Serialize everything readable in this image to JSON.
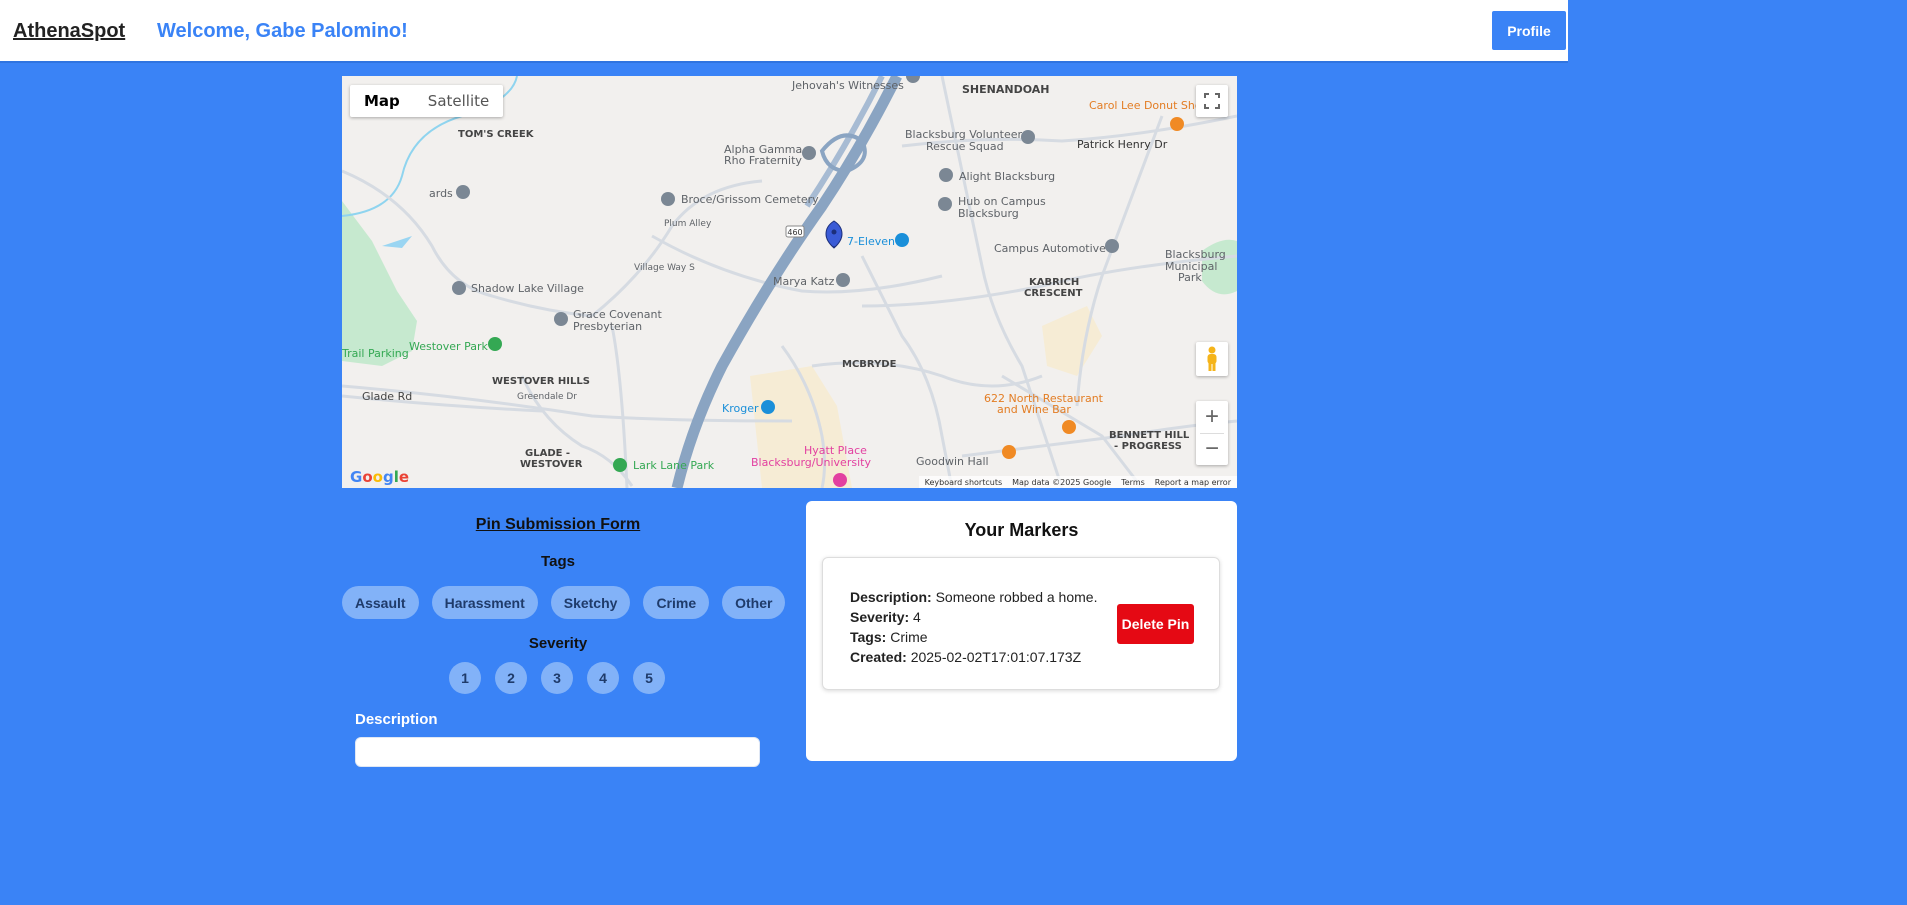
{
  "header": {
    "brand": "AthenaSpot",
    "welcome": "Welcome, Gabe Palomino!",
    "profile_label": "Profile"
  },
  "map": {
    "toggle": {
      "map": "Map",
      "satellite": "Satellite"
    },
    "labels": {
      "shenandoah": "SHENANDOAH",
      "jehovah": "Jehovah's Witnesses",
      "toms_creek": "TOM'S CREEK",
      "carol_lee": "Carol Lee Donut Sho",
      "volunteer_rescue_1": "Blacksburg Volunteer",
      "volunteer_rescue_2": "Rescue Squad",
      "patrick_henry": "Patrick Henry Dr",
      "alpha_gamma_1": "Alpha Gamma",
      "alpha_gamma_2": "Rho Fraternity",
      "alight": "Alight Blacksburg",
      "hub_1": "Hub on Campus",
      "hub_2": "Blacksburg",
      "ards": "ards",
      "bruce_cemetery": "Broce/Grissom Cemetery",
      "plum_alley": "Plum Alley",
      "seven_eleven": "7-Eleven",
      "campus_auto": "Campus Automotive",
      "bmp_1": "Blacksburg",
      "bmp_2": "Municipal",
      "bmp_3": "Park",
      "village_way": "Village Way S",
      "marya": "Marya Katz",
      "kabrich_1": "KABRICH",
      "kabrich_2": "CRESCENT",
      "shadow_lake_village": "Shadow Lake Village",
      "grace_1": "Grace Covenant",
      "grace_2": "Presbyterian",
      "westover_park": "Westover Park",
      "trail_parking": "Trail Parking",
      "mcbryde": "MCBRYDE",
      "westover_hills": "WESTOVER HILLS",
      "glade_rd": "Glade Rd",
      "greendale": "Greendale Dr",
      "kroger": "Kroger",
      "north_rest_1": "622 North Restaurant",
      "north_rest_2": "and Wine Bar",
      "bennett_1": "BENNETT HILL",
      "bennett_2": "- PROGRESS",
      "glade_westover_1": "GLADE -",
      "glade_westover_2": "WESTOVER",
      "lark_lane": "Lark Lane Park",
      "hyatt_1": "Hyatt Place",
      "hyatt_2": "Blacksburg/University",
      "goodwin": "Goodwin Hall",
      "route": "460"
    },
    "google": "Google",
    "attribution": {
      "shortcuts": "Keyboard shortcuts",
      "data": "Map data ©2025 Google",
      "terms": "Terms",
      "report": "Report a map error"
    }
  },
  "form": {
    "title": "Pin Submission Form",
    "tags_label": "Tags",
    "tags": [
      "Assault",
      "Harassment",
      "Sketchy",
      "Crime",
      "Other"
    ],
    "severity_label": "Severity",
    "severity_options": [
      "1",
      "2",
      "3",
      "4",
      "5"
    ],
    "description_label": "Description"
  },
  "markers": {
    "title": "Your Markers",
    "items": [
      {
        "description_label": "Description:",
        "description": "Someone robbed a home.",
        "severity_label": "Severity:",
        "severity": "4",
        "tags_label": "Tags:",
        "tags": "Crime",
        "created_label": "Created:",
        "created": "2025-02-02T17:01:07.173Z",
        "delete_label": "Delete Pin"
      }
    ]
  },
  "colors": {
    "background": "#3a83f6",
    "tag_pill": "#82b2f8",
    "delete": "#e50914"
  }
}
